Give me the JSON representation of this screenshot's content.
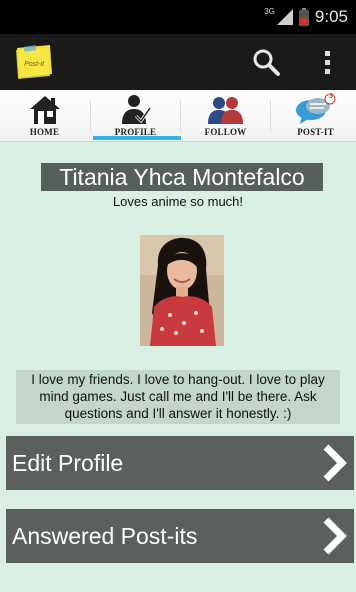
{
  "status_bar": {
    "network": "3G",
    "time": "9:05"
  },
  "action_bar": {
    "logo_text": "Post-it",
    "logo_color": "#f3e13a",
    "search_icon": "search-icon",
    "overflow_icon": "overflow-menu-icon"
  },
  "tabs": [
    {
      "label": "HOME",
      "icon": "home-icon"
    },
    {
      "label": "PROFILE",
      "icon": "profile-icon",
      "selected": true
    },
    {
      "label": "FOLLOW",
      "icon": "follow-icon"
    },
    {
      "label": "POST-IT",
      "icon": "post-it-icon",
      "badge": "3"
    }
  ],
  "profile": {
    "name": "Titania Yhca Montefalco",
    "tagline": "Loves anime so much!",
    "bio": "I love my friends. I love to hang-out. I love to play mind games. Just call me and I'll be there. Ask questions and I'll answer it honestly. :)"
  },
  "menu": {
    "edit_profile": "Edit Profile",
    "answered_post_its": "Answered Post-its"
  },
  "colors": {
    "background": "#d9efe4",
    "accent": "#33b5e5",
    "row": "#5b5f5d"
  }
}
